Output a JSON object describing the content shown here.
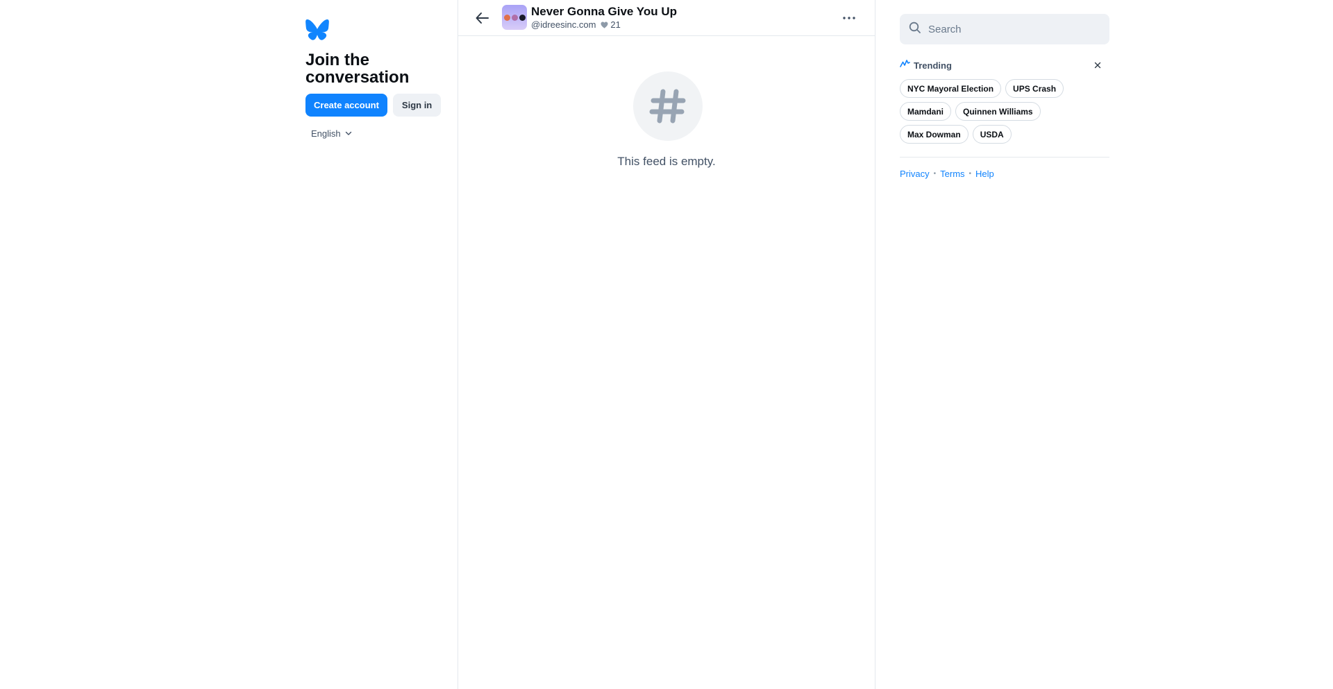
{
  "left": {
    "logo_icon": "butterfly-logo-icon",
    "join_title": "Join the conversation",
    "create_account_label": "Create account",
    "sign_in_label": "Sign in",
    "language": "English"
  },
  "feed": {
    "title": "Never Gonna Give You Up",
    "handle": "@idreesinc.com",
    "like_count": "21",
    "empty_text": "This feed is empty.",
    "avatar_dot_colors": [
      "#e0704b",
      "#b06ea8",
      "#1a1a2a"
    ]
  },
  "right": {
    "search_placeholder": "Search",
    "trending_label": "Trending",
    "trending_topics": [
      "NYC Mayoral Election",
      "UPS Crash",
      "Mamdani",
      "Quinnen Williams",
      "Max Dowman",
      "USDA"
    ],
    "footer_links": [
      "Privacy",
      "Terms",
      "Help"
    ]
  },
  "colors": {
    "accent": "#1083fe",
    "muted_text": "#425165",
    "border": "#e4e8ed"
  }
}
